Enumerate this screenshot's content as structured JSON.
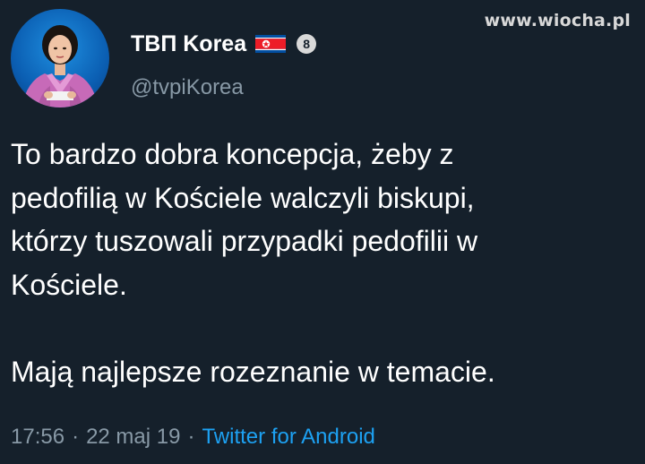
{
  "watermark": "www.wiocha.pl",
  "profile": {
    "display_name": "ТВП Korea",
    "handle": "@tvpiKorea",
    "badge": "8",
    "flag_icon": "north-korea-flag-icon"
  },
  "tweet": {
    "text": "To bardzo dobra koncepcja, żeby z\npedofilią w Kościele walczyli biskupi,\nktórzy tuszowali przypadki pedofilii w\nKościele.\n\nMają najlepsze rozeznanie w temacie.",
    "time": "17:56",
    "date": "22 maj 19",
    "separator": "·",
    "source": "Twitter for Android"
  },
  "colors": {
    "background": "#15202b",
    "text": "#ffffff",
    "secondary": "#8899a6",
    "link": "#1da1f2"
  }
}
